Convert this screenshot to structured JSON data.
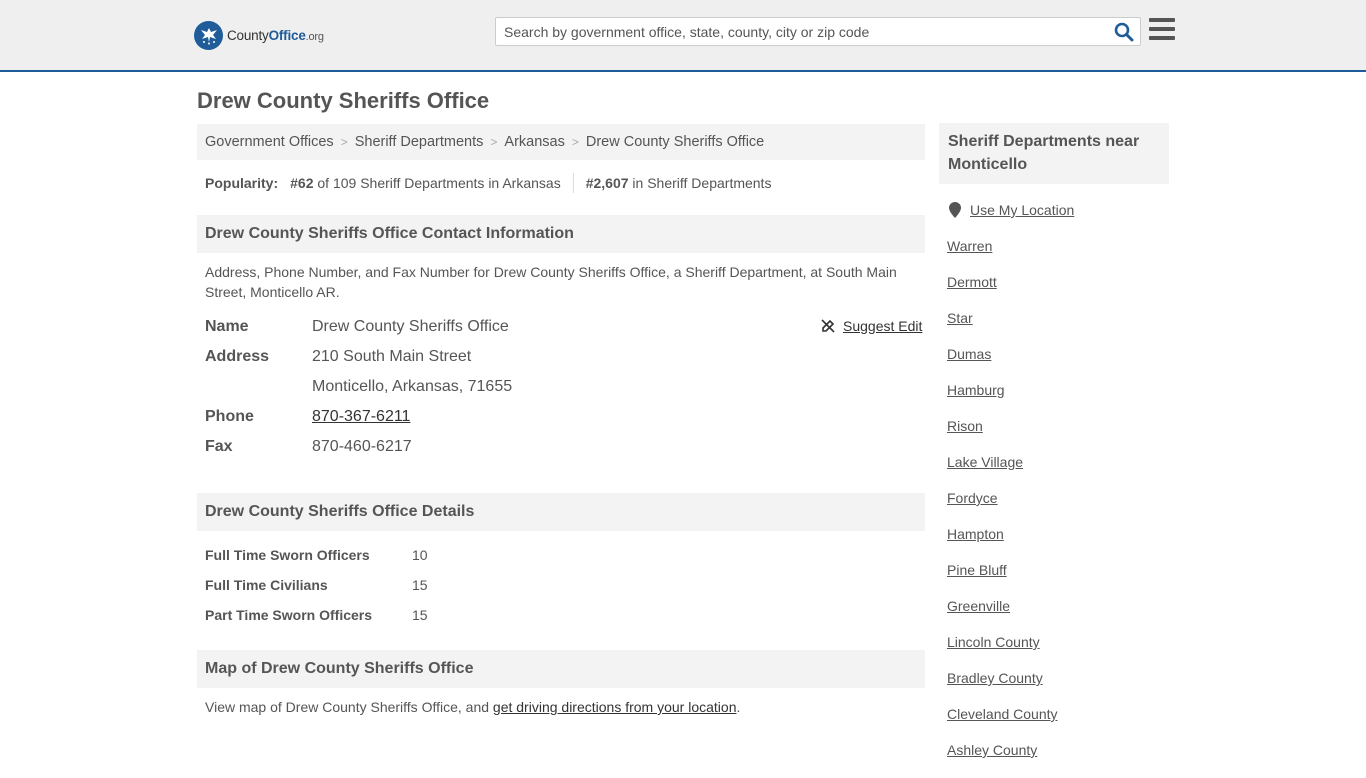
{
  "header": {
    "logo_county": "County",
    "logo_office": "Office",
    "logo_org": ".org",
    "search_placeholder": "Search by government office, state, county, city or zip code",
    "search_icon": "search-icon",
    "menu_icon": "hamburger-menu-icon"
  },
  "page": {
    "title": "Drew County Sheriffs Office"
  },
  "breadcrumbs": [
    "Government Offices",
    "Sheriff Departments",
    "Arkansas",
    "Drew County Sheriffs Office"
  ],
  "popularity": {
    "label": "Popularity:",
    "state_rank": "#62",
    "state_text": "of 109 Sheriff Departments in Arkansas",
    "national_rank": "#2,607",
    "national_text": "in Sheriff Departments"
  },
  "contact": {
    "heading": "Drew County Sheriffs Office Contact Information",
    "description": "Address, Phone Number, and Fax Number for Drew County Sheriffs Office, a Sheriff Department, at South Main Street, Monticello AR.",
    "suggest_edit": "Suggest Edit",
    "name_label": "Name",
    "name_value": "Drew County Sheriffs Office",
    "address_label": "Address",
    "address_line1": "210 South Main Street",
    "address_line2": "Monticello, Arkansas, 71655",
    "phone_label": "Phone",
    "phone_value": "870-367-6211",
    "fax_label": "Fax",
    "fax_value": "870-460-6217"
  },
  "details": {
    "heading": "Drew County Sheriffs Office Details",
    "rows": [
      {
        "label": "Full Time Sworn Officers",
        "value": "10"
      },
      {
        "label": "Full Time Civilians",
        "value": "15"
      },
      {
        "label": "Part Time Sworn Officers",
        "value": "15"
      }
    ]
  },
  "map": {
    "heading": "Map of Drew County Sheriffs Office",
    "text_before": "View map of Drew County Sheriffs Office, and ",
    "link": "get driving directions from your location",
    "text_after": "."
  },
  "sidebar": {
    "heading": "Sheriff Departments near Monticello",
    "use_location": "Use My Location",
    "places": [
      "Warren",
      "Dermott",
      "Star",
      "Dumas",
      "Hamburg",
      "Rison",
      "Lake Village",
      "Fordyce",
      "Hampton",
      "Pine Bluff",
      "Greenville",
      "Lincoln County",
      "Bradley County",
      "Cleveland County",
      "Ashley County"
    ]
  },
  "colors": {
    "brand_blue": "#1f5c99",
    "header_bg": "#efefef",
    "section_bg": "#f3f3f3",
    "text": "#555555"
  }
}
